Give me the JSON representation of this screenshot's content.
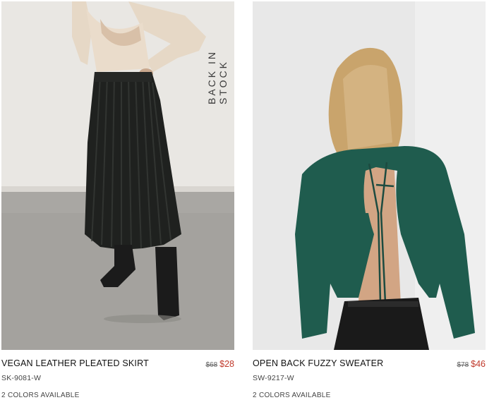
{
  "products": [
    {
      "name": "VEGAN LEATHER PLEATED SKIRT",
      "sku": "SK-9081-W",
      "price_original": "$68",
      "price_sale": "$28",
      "colors_available": "2 COLORS AVAILABLE",
      "badge": "BACK IN STOCK",
      "image_icon": "skirt-photo"
    },
    {
      "name": "OPEN BACK FUZZY SWEATER",
      "sku": "SW-9217-W",
      "price_original": "$78",
      "price_sale": "$46",
      "colors_available": "2 COLORS AVAILABLE",
      "image_icon": "sweater-photo"
    }
  ],
  "colors": {
    "sale_price": "#c0392b",
    "text": "#111111",
    "muted": "#666666"
  }
}
